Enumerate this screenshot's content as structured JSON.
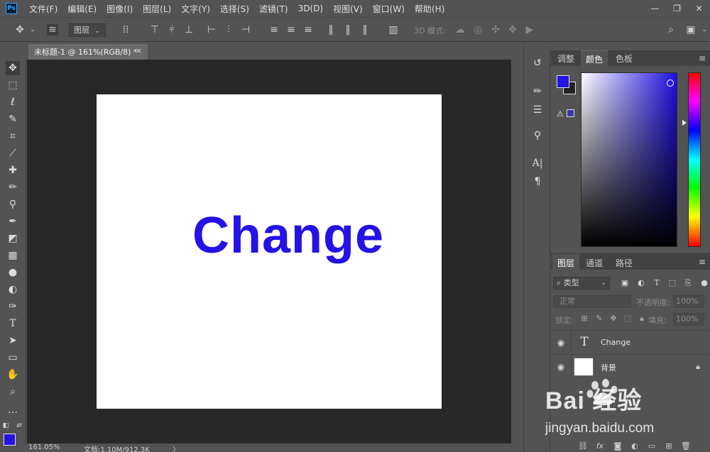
{
  "app": {
    "logo": "Ps"
  },
  "menu": [
    "文件(F)",
    "编辑(E)",
    "图像(I)",
    "图层(L)",
    "文字(Y)",
    "选择(S)",
    "滤镜(T)",
    "3D(D)",
    "视图(V)",
    "窗口(W)",
    "帮助(H)"
  ],
  "window_controls": {
    "minimize": "—",
    "restore": "❐",
    "close": "✕"
  },
  "options": {
    "auto_select_target": "图层",
    "mode3d_label": "3D 模式:"
  },
  "document": {
    "tab_title": "未标题-1 @ 161%(RGB/8) *",
    "tab_close": "×",
    "text_layer_content": "Change",
    "text_color": "#2412e6"
  },
  "status": {
    "zoom": "161.05%",
    "doc_size": "文档:1.10M/912.3K",
    "arrow": "〉"
  },
  "color_panel": {
    "tabs": [
      "调整",
      "颜色",
      "色板"
    ],
    "active_tab": "颜色",
    "foreground": "#2412e6",
    "background": "#222222",
    "gamut_warning": "⚠"
  },
  "layers_panel": {
    "tabs": [
      "图层",
      "通道",
      "路径"
    ],
    "active_tab": "图层",
    "filter_label": "⌕ 类型",
    "blend_mode": "正常",
    "opacity_label": "不透明度:",
    "opacity_value": "100%",
    "lock_label": "锁定:",
    "fill_label": "填充:",
    "fill_value": "100%",
    "layers": [
      {
        "name": "Change",
        "thumb": "T",
        "type": "text",
        "visible": true
      },
      {
        "name": "背景",
        "type": "background",
        "visible": true,
        "locked": true
      }
    ]
  },
  "watermark": {
    "logo": "Bai 经验",
    "url": "jingyan.baidu.com"
  }
}
